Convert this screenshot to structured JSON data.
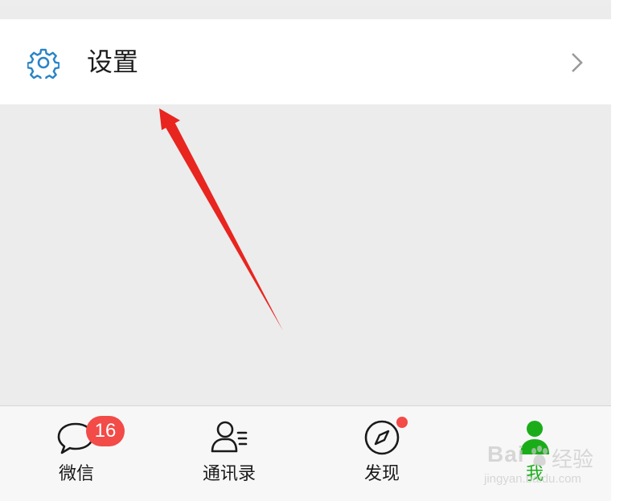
{
  "settings": {
    "label": "设置",
    "icon": "gear-icon",
    "chevron_icon": "chevron-right-icon"
  },
  "tabbar": {
    "tabs": [
      {
        "label": "微信",
        "icon": "chat-bubble-icon",
        "badge": "16",
        "active": false
      },
      {
        "label": "通讯录",
        "icon": "contacts-icon",
        "active": false
      },
      {
        "label": "发现",
        "icon": "compass-icon",
        "has_dot": true,
        "active": false
      },
      {
        "label": "我",
        "icon": "person-icon",
        "active": true
      }
    ]
  },
  "colors": {
    "accent_green": "#1aad19",
    "badge_red": "#f24b48",
    "icon_blue": "#2a84c6",
    "annotation_arrow": "#e8251f"
  },
  "watermark": {
    "brand": "Bai",
    "brand_cn": "经验",
    "url": "jingyan.baidu.com"
  }
}
